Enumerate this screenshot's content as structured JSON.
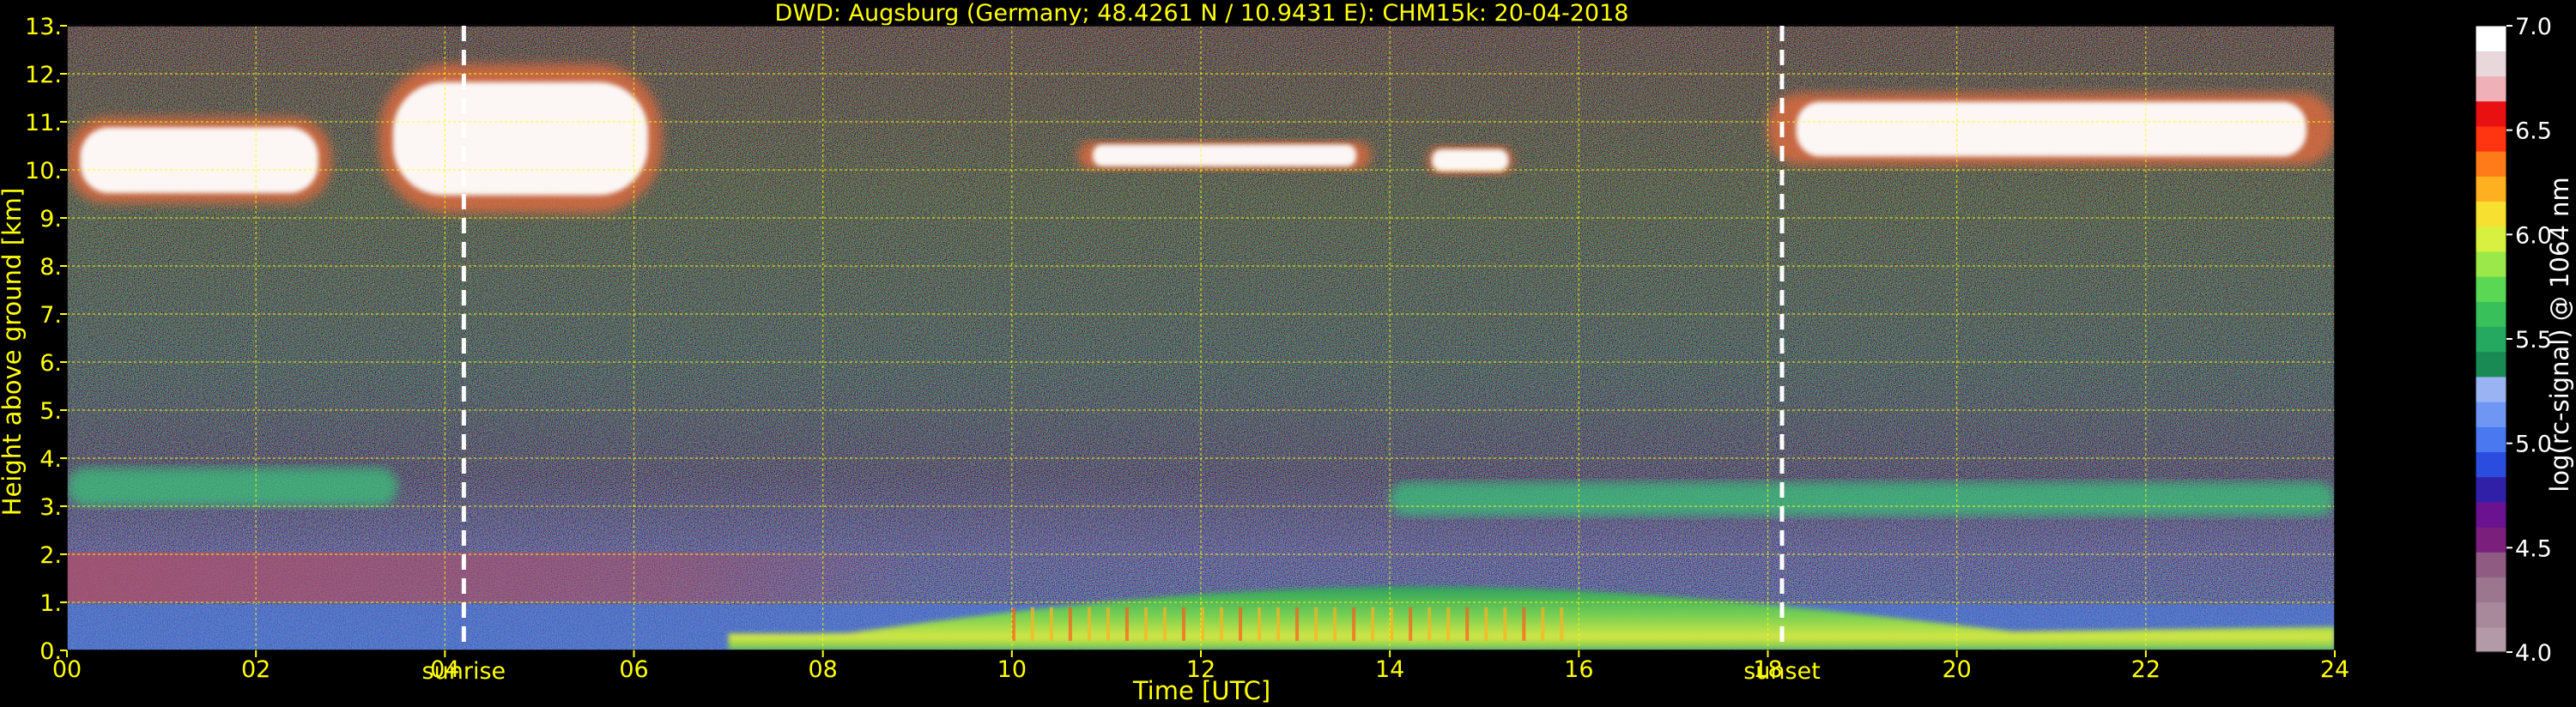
{
  "chart_data": {
    "type": "heatmap",
    "title": "DWD: Augsburg (Germany; 48.4261 N / 10.9431 E):    CHM15k: 20-04-2018",
    "xlabel": "Time [UTC]",
    "ylabel": "Height above ground [km]",
    "xlim": [
      0,
      24
    ],
    "ylim": [
      0,
      13
    ],
    "x_ticks": [
      "00",
      "02",
      "04",
      "06",
      "08",
      "10",
      "12",
      "14",
      "16",
      "18",
      "20",
      "22",
      "24"
    ],
    "y_ticks": [
      "0.",
      "1.",
      "2.",
      "3.",
      "4.",
      "5.",
      "6.",
      "7.",
      "8.",
      "9.",
      "10.",
      "11.",
      "12.",
      "13."
    ],
    "grid": true,
    "markers": [
      {
        "label": "sunrise",
        "x": 4.2
      },
      {
        "label": "sunset",
        "x": 18.15
      }
    ],
    "colorbar": {
      "label": "log(rc-signal) @ 1064 nm",
      "range": [
        4.0,
        7.0
      ],
      "ticks": [
        "4.0",
        "4.5",
        "5.0",
        "5.5",
        "6.0",
        "6.5",
        "7.0"
      ],
      "colors": [
        "#b39aa8",
        "#a8889b",
        "#9c758e",
        "#8f5b82",
        "#7b1f7d",
        "#6a128f",
        "#3020a8",
        "#2a4de0",
        "#4a78f0",
        "#6f96f3",
        "#9ab4f3",
        "#1a8a55",
        "#25a860",
        "#38c05a",
        "#5ad854",
        "#9ae84a",
        "#d8f040",
        "#f8e030",
        "#ffb020",
        "#ff7a18",
        "#ff3410",
        "#e81010",
        "#f0b0b8",
        "#e8d8dc",
        "#ffffff"
      ]
    },
    "features": [
      {
        "label": "cirrus cloud (white)",
        "x": [
          0.0,
          2.8
        ],
        "y": [
          9.3,
          11.1
        ]
      },
      {
        "label": "cirrus cloud (white)",
        "x": [
          3.3,
          6.3
        ],
        "y": [
          9.1,
          12.2
        ]
      },
      {
        "label": "cirrus cloud (white)",
        "x": [
          10.7,
          13.8
        ],
        "y": [
          10.0,
          10.6
        ]
      },
      {
        "label": "cirrus cloud (white)",
        "x": [
          14.4,
          15.3
        ],
        "y": [
          9.9,
          10.5
        ]
      },
      {
        "label": "cirrus cloud (white)",
        "x": [
          18.0,
          24.0
        ],
        "y": [
          10.1,
          11.6
        ]
      },
      {
        "label": "aerosol layer (green)",
        "x": [
          0.0,
          3.5
        ],
        "y": [
          3.0,
          3.8
        ]
      },
      {
        "label": "aerosol layer (green)",
        "x": [
          14.0,
          24.0
        ],
        "y": [
          2.8,
          3.5
        ]
      },
      {
        "label": "boundary layer (yellow-green)",
        "x": [
          7.0,
          24.0
        ],
        "y": [
          0.0,
          1.4
        ]
      }
    ]
  }
}
